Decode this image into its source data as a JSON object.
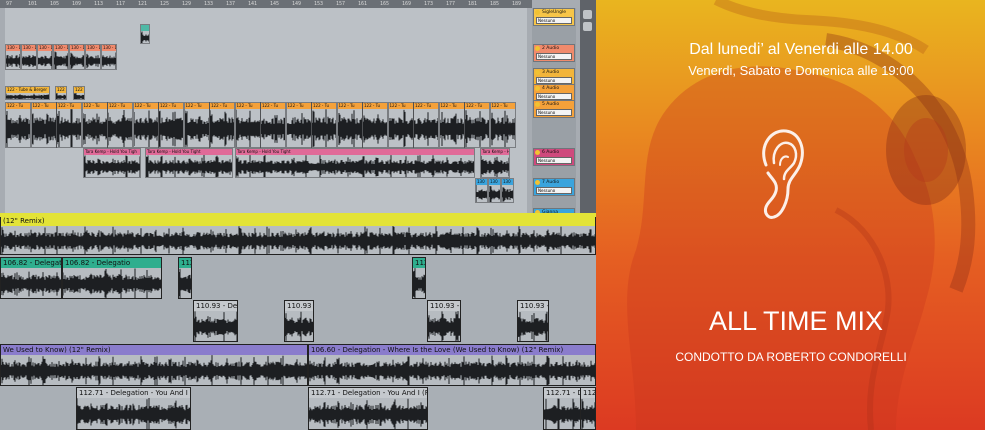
{
  "daw": {
    "ruler_ticks": [
      "97",
      "101",
      "105",
      "109",
      "113",
      "117",
      "121",
      "125",
      "129",
      "133",
      "137",
      "141",
      "145",
      "149",
      "153",
      "157",
      "161",
      "165",
      "169",
      "173",
      "177",
      "181",
      "185",
      "189"
    ],
    "tracks": [
      {
        "color": "#f7c548",
        "mixer_label": "SigleUngle",
        "selector": "Nessuno"
      },
      {
        "color": "#f08a6c",
        "mixer_label": "2 Audio",
        "selector": "Nessuno"
      },
      {
        "color": "#f2b53b",
        "mixer_label": "3 Audio",
        "selector": "Nessuno"
      },
      {
        "color": "#f4a13a",
        "mixer_label": "4 Audio",
        "selector": "Nessuno"
      },
      {
        "color": "#f4a13a",
        "mixer_label": "5 Audio",
        "selector": "Nessuno"
      },
      {
        "color": "#cf4a7d",
        "mixer_label": "6 Audio",
        "selector": "Nessuno"
      },
      {
        "color": "#3aa4dd",
        "mixer_label": "7 Audio",
        "selector": "Nessuno"
      },
      {
        "color": "#3aa4dd",
        "mixer_label": "Gianna",
        "selector": ""
      }
    ],
    "clips": {
      "track2": [
        "130 - Da",
        "130 - Da",
        "130 - Da",
        "130 - Da",
        "130 - Da",
        "130 - Da",
        "130 - Da"
      ],
      "track3": [
        "122 - Tube & Berger",
        "122",
        "122"
      ],
      "track5": [
        "122 - Tu",
        "122 - Tu",
        "122 - Tu",
        "122 - Tu",
        "122 - Tu",
        "122 - Tu",
        "122 - Tu",
        "122 - Tu",
        "122 - Tu",
        "122 - Tu",
        "122 - Tu",
        "122 - Tu",
        "122 - Tu",
        "122 - Tu",
        "122 - Tu",
        "122 - Tu",
        "122 - Tu",
        "122 - Tu",
        "122 - Tu",
        "122 - Tu"
      ],
      "track6": [
        "Tara Kemp - Hold You Tigh",
        "Tara Kemp - Hold You Tight",
        "Tara Kemp - Hold You Tight",
        "Tara Kemp - Hold"
      ],
      "track7": [
        "130",
        "130",
        "130"
      ]
    },
    "detail": {
      "row1_label": "(12\" Remix)",
      "row2_clips": [
        "106.82 - Delegatio",
        "106.82 - Delegatio",
        "112",
        "112"
      ],
      "row3_clips": [
        "110.93 - Dele",
        "110.93 -",
        "110.93 -",
        "110.93 -"
      ],
      "row4_labels": [
        "We Used to Know) (12\" Remix)",
        "106.60 - Delegation - Where Is the Love (We Used to Know) (12\" Remix)"
      ],
      "row5_clips": [
        "112.71 - Delegation - You And I (Rem",
        "112.71 - Delegation - You And I (Rem",
        "112.71 - Delegation - You And I (Rem",
        "112.71 -"
      ]
    }
  },
  "promo": {
    "schedule_line1": "Dal lunedi’ al Venerdi alle 14.00",
    "schedule_line2": "Venerdi, Sabato e Domenica alle 19:00",
    "ear_icon": "ear-icon",
    "show_title": "ALL TIME MIX",
    "host_line": "CONDOTTO DA ROBERTO CONDORELLI"
  }
}
